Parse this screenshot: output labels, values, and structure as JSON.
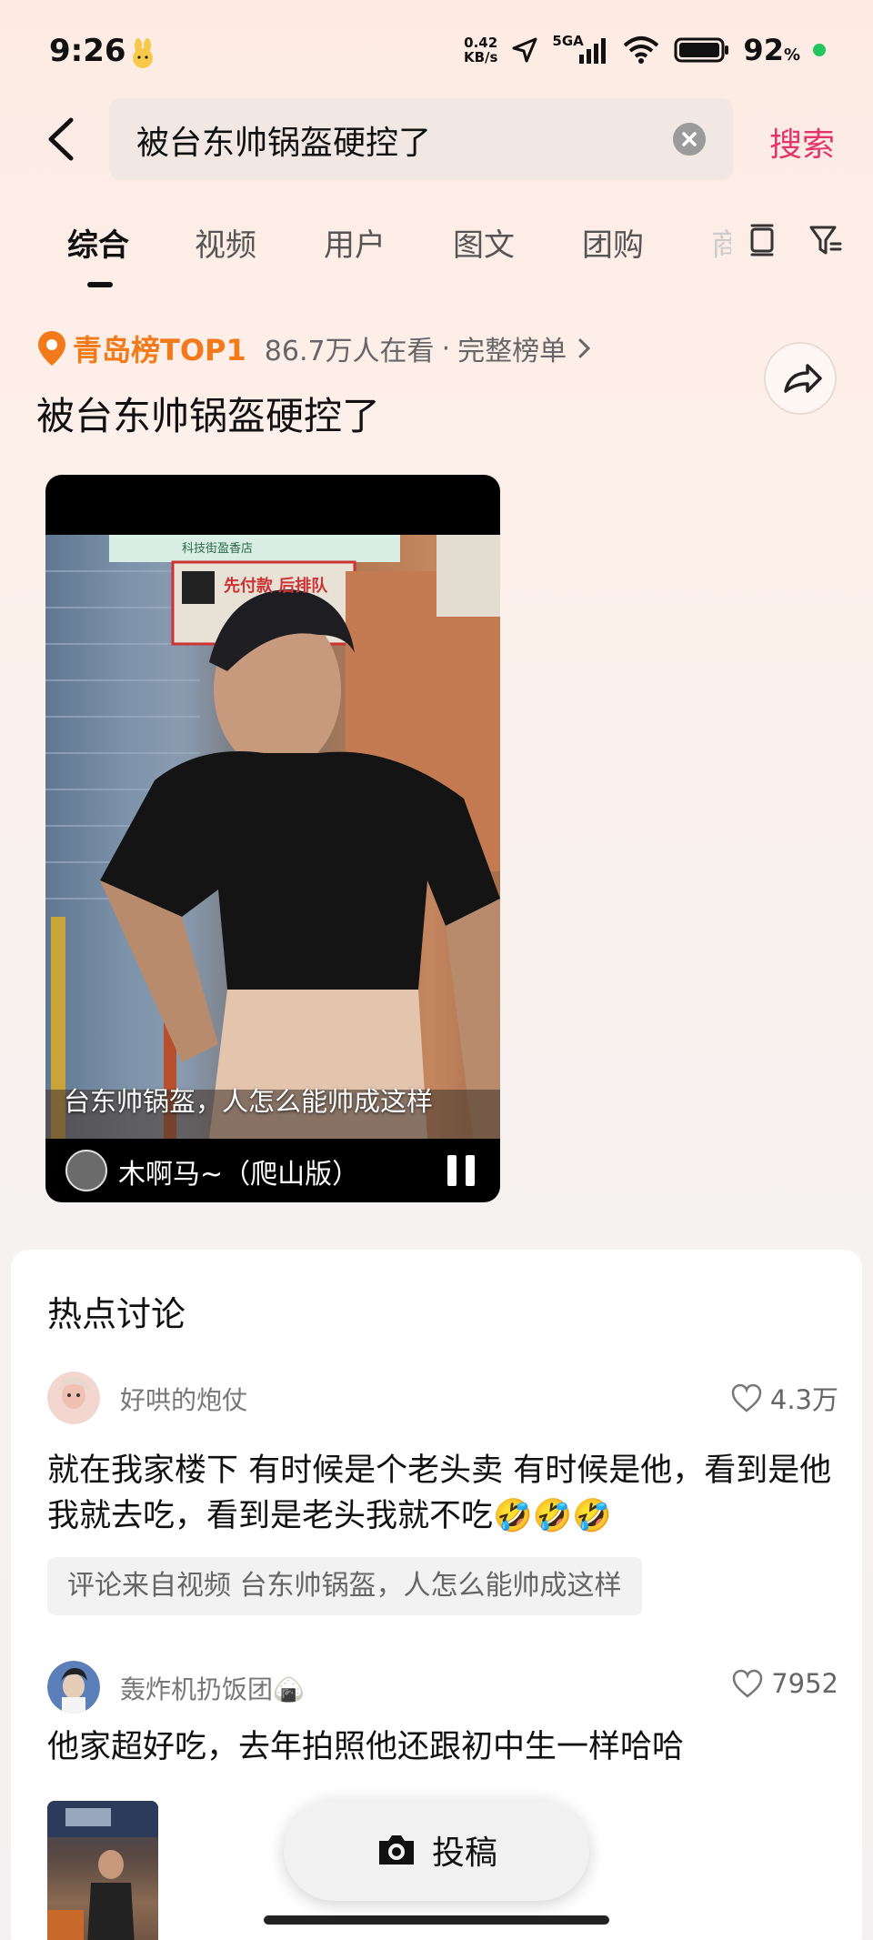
{
  "status_bar": {
    "time": "9:26",
    "net_speed_value": "0.42",
    "net_speed_unit": "KB/s",
    "network": "5GA",
    "battery_percent": "92",
    "battery_unit": "%"
  },
  "search": {
    "query": "被台东帅锅盔硬控了",
    "search_button": "搜索"
  },
  "tabs": [
    {
      "label": "综合",
      "active": true
    },
    {
      "label": "视频"
    },
    {
      "label": "用户"
    },
    {
      "label": "图文"
    },
    {
      "label": "团购"
    },
    {
      "label": "商"
    }
  ],
  "ranking": {
    "title": "青岛榜TOP1",
    "viewers": "86.7万人在看",
    "separator": "·",
    "full_list": "完整榜单",
    "topic_title": "被台东帅锅盔硬控了"
  },
  "video": {
    "caption": "台东帅锅盔，人怎么能帅成这样",
    "music": "木啊马~（爬山版）",
    "sign_line1": "先付款 后排队",
    "sign_line2": "科技街盈香店"
  },
  "discussion": {
    "title": "热点讨论",
    "comments": [
      {
        "user": "好哄的炮仗",
        "likes": "4.3万",
        "text": "就在我家楼下 有时候是个老头卖 有时候是他，看到是他我就去吃，看到是老头我就不吃🤣🤣🤣",
        "source": "评论来自视频 台东帅锅盔，人怎么能帅成这样"
      },
      {
        "user": "轰炸机扔饭团🍙",
        "likes": "7952",
        "text": "他家超好吃，去年拍照他还跟初中生一样哈哈"
      }
    ]
  },
  "fab": {
    "label": "投稿"
  },
  "colors": {
    "accent": "#e2366b",
    "rank_orange": "#f27a1a"
  }
}
